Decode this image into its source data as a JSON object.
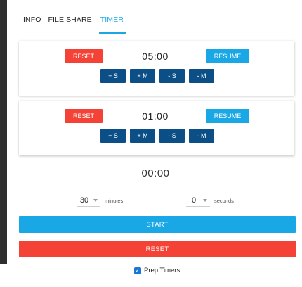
{
  "tabs": [
    {
      "label": "INFO"
    },
    {
      "label": "FILE SHARE"
    },
    {
      "label": "TIMER",
      "active": true
    }
  ],
  "prep_timers": [
    {
      "reset_label": "RESET",
      "time": "05:00",
      "resume_label": "RESUME",
      "adjust": [
        "+ S",
        "+ M",
        "- S",
        "- M"
      ]
    },
    {
      "reset_label": "RESET",
      "time": "01:00",
      "resume_label": "RESUME",
      "adjust": [
        "+ S",
        "+ M",
        "- S",
        "- M"
      ]
    }
  ],
  "main_timer": {
    "time": "00:00",
    "minutes_value": "30",
    "minutes_unit": "minutes",
    "seconds_value": "0",
    "seconds_unit": "seconds",
    "start_label": "START",
    "reset_label": "RESET"
  },
  "prep_checkbox": {
    "label": "Prep Timers",
    "checked": true
  },
  "colors": {
    "accent": "#1aa7e6",
    "danger": "#f44336",
    "adjust": "#0b4f86"
  },
  "icons": {
    "check": "✓"
  }
}
